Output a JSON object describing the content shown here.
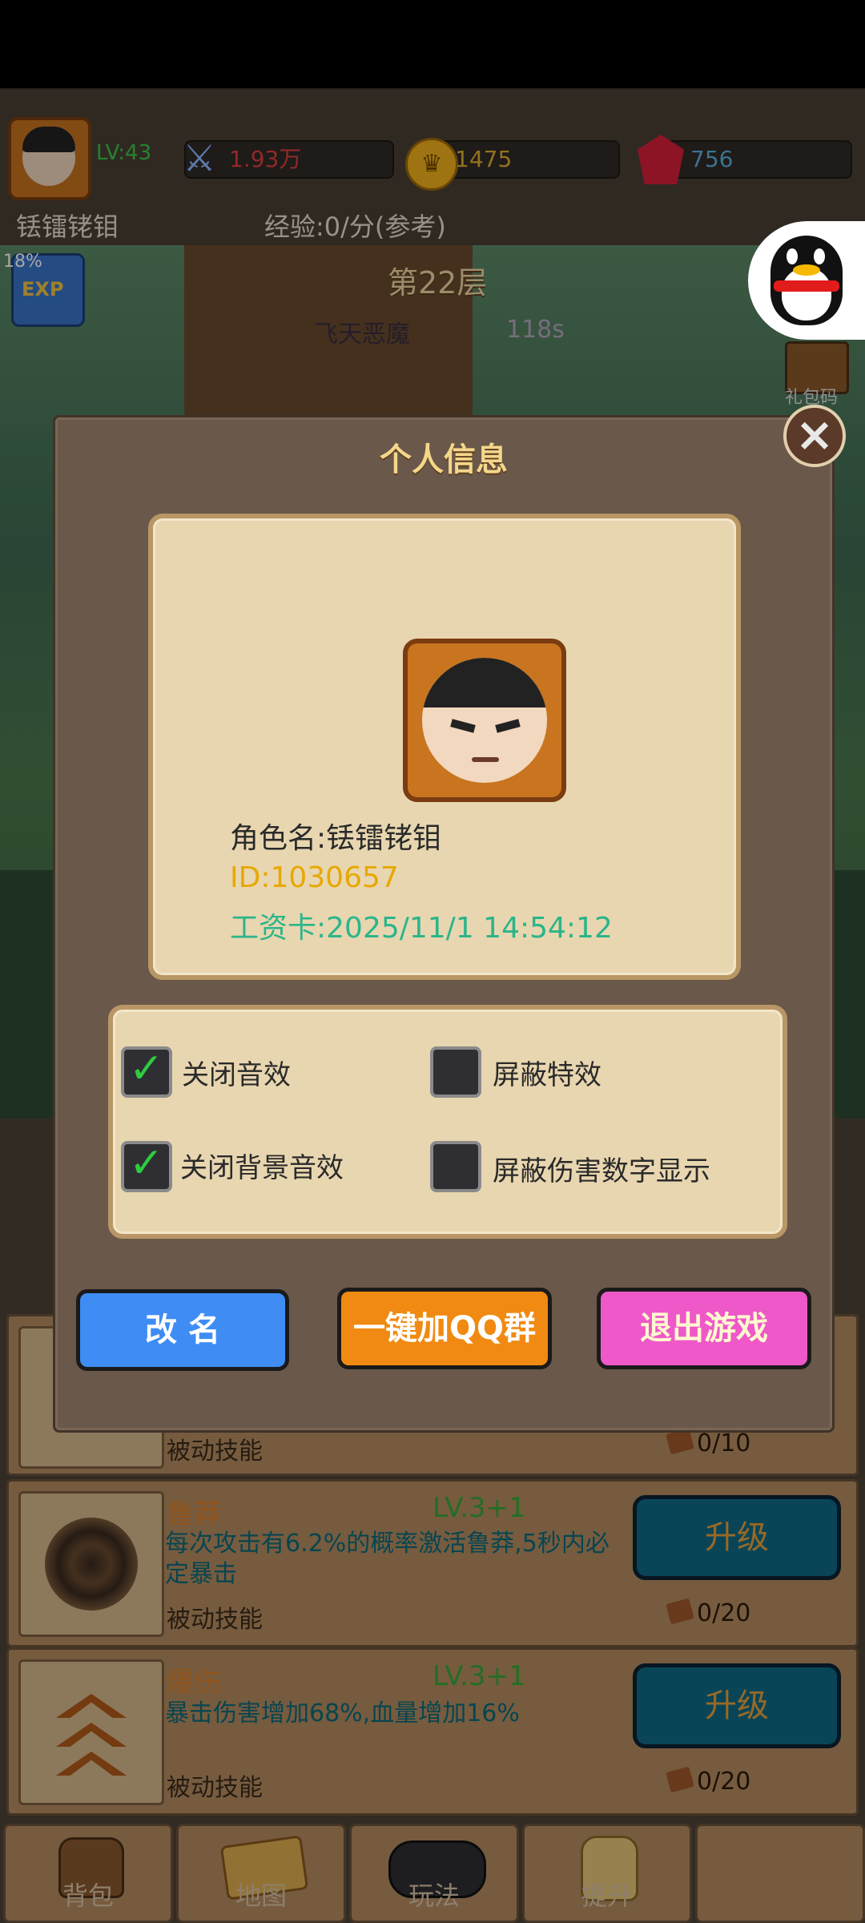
{
  "header": {
    "level": "LV:43",
    "power": "1.93万",
    "gold": "1475",
    "gems": "756",
    "player_name": "铥镭铑钼",
    "exp_rate": "经验:0/分(参考)"
  },
  "scene": {
    "floor_label": "第22层",
    "enemy_name": "飞天恶魔",
    "timer": "118s",
    "exp_buff_percent": "18%",
    "exp_badge_text": "EXP",
    "gift_code_label": "礼包码"
  },
  "modal": {
    "title": "个人信息",
    "role_name": "角色名:铥镭铑钼",
    "id": "ID:1030657",
    "salary_card": "工资卡:2025/11/1 14:54:12",
    "settings": [
      {
        "label": "关闭音效",
        "checked": true
      },
      {
        "label": "屏蔽特效",
        "checked": false
      },
      {
        "label": "关闭背景音效",
        "checked": true
      },
      {
        "label": "屏蔽伤害数字显示",
        "checked": false
      }
    ],
    "buttons": {
      "rename": "改 名",
      "join_qq": "一键加QQ群",
      "quit": "退出游戏"
    }
  },
  "skills": [
    {
      "name": "",
      "level": "",
      "desc": "",
      "type": "被动技能",
      "cost": "0/10",
      "button": ""
    },
    {
      "name": "鲁莽",
      "level": "LV.3+1",
      "desc": "每次攻击有6.2%的概率激活鲁莽,5秒内必定暴击",
      "type": "被动技能",
      "cost": "0/20",
      "button": "升级"
    },
    {
      "name": "爆伤",
      "level": "LV.3+1",
      "desc": "暴击伤害增加68%,血量增加16%",
      "type": "被动技能",
      "cost": "0/20",
      "button": "升级"
    }
  ],
  "nav": {
    "bag": "背包",
    "map": "地图",
    "gameplay": "玩法",
    "upgrade": "提升"
  },
  "colors": {
    "rename_btn": "#3f8cf5",
    "qq_btn": "#f08a12",
    "quit_btn": "#ee58c8",
    "info_id_color": "#e8a800",
    "info_date_color": "#2bb58a"
  }
}
